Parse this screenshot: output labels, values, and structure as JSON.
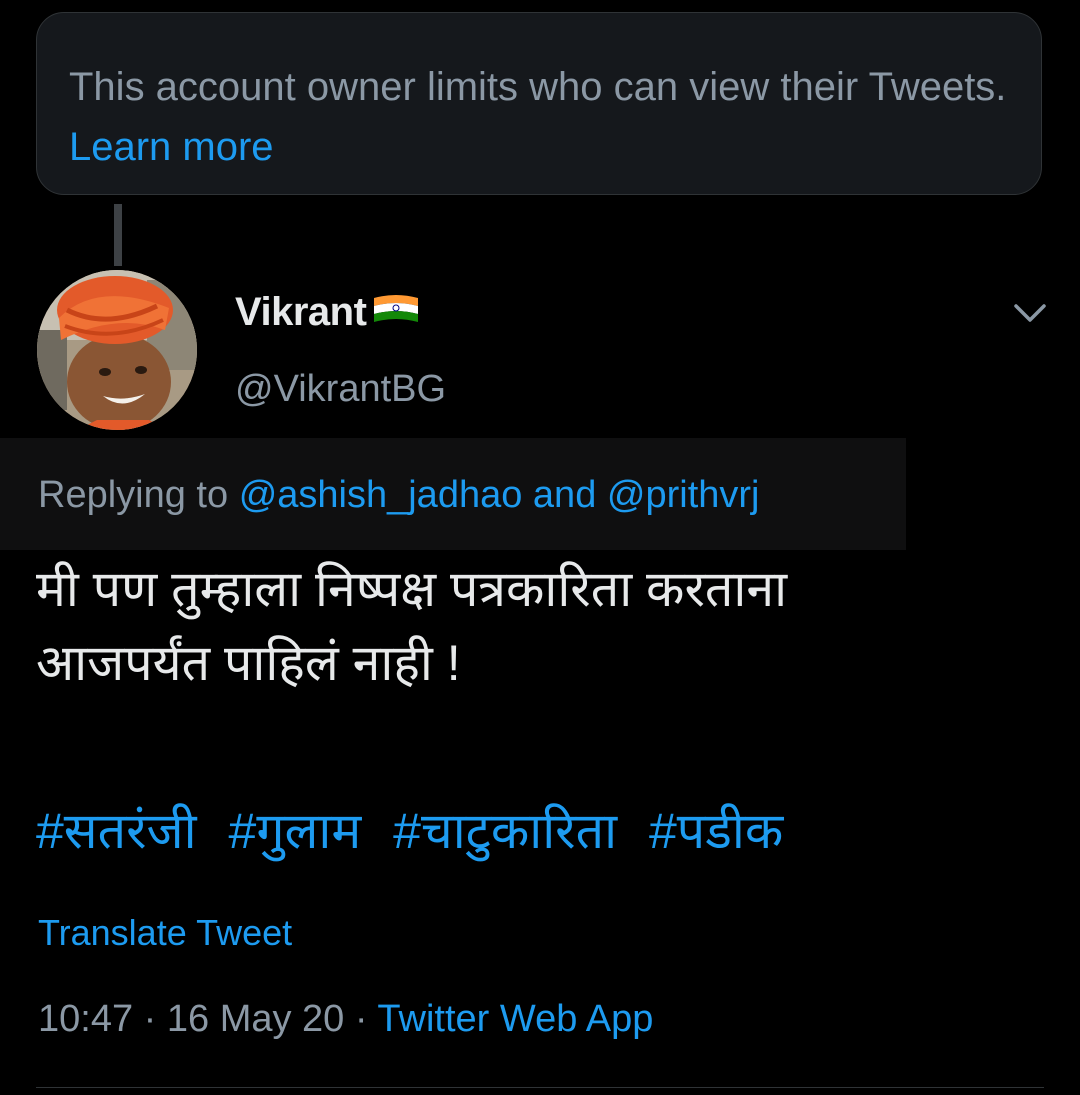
{
  "notice": {
    "text": "This account owner limits who can view their Tweets.",
    "link": "Learn more"
  },
  "user": {
    "display_name": "Vikrant",
    "flag_icon": "indian-flag-emoji",
    "handle": "@VikrantBG"
  },
  "reply": {
    "prefix": "Replying to",
    "mention1": "@ashish_jadhao",
    "joiner": "and",
    "mention2": "@prithvrj"
  },
  "tweet": {
    "line1": "मी पण तुम्हाला निष्पक्ष पत्रकारिता करताना",
    "line2": "आजपर्यंत पाहिलं नाही !",
    "hashtags": [
      "#सतरंजी",
      "#गुलाम",
      "#चाटुकारिता",
      "#पडीक"
    ]
  },
  "translate_label": "Translate Tweet",
  "meta": {
    "time": "10:47",
    "sep1": "·",
    "date": "16 May 20",
    "sep2": "·",
    "source": "Twitter Web App"
  },
  "colors": {
    "background": "#000000",
    "accent": "#1d9bf0",
    "muted": "#8b98a5",
    "text": "#e7e9ea"
  }
}
